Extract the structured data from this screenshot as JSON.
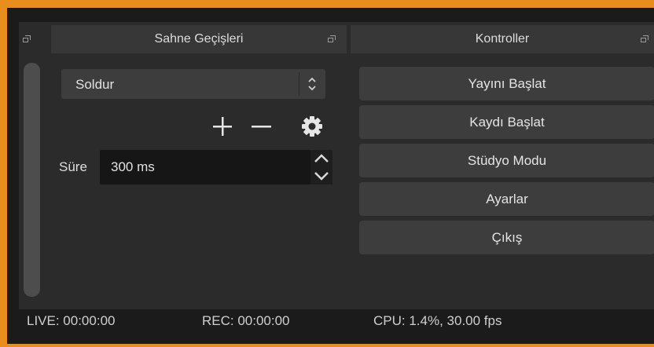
{
  "transitions_panel": {
    "title": "Sahne Geçişleri",
    "transition_select": {
      "value": "Soldur"
    },
    "duration": {
      "label": "Süre",
      "value": "300 ms"
    },
    "icons": {
      "add": "plus-icon",
      "remove": "minus-icon",
      "settings": "gear-icon"
    }
  },
  "controls_panel": {
    "title": "Kontroller",
    "buttons": [
      {
        "label": "Yayını Başlat"
      },
      {
        "label": "Kaydı Başlat"
      },
      {
        "label": "Stüdyo Modu"
      },
      {
        "label": "Ayarlar"
      },
      {
        "label": "Çıkış"
      }
    ]
  },
  "status_bar": {
    "live": "LIVE: 00:00:00",
    "rec": "REC: 00:00:00",
    "cpu": "CPU: 1.4%, 30.00 fps"
  },
  "colors": {
    "frame_border": "#e88e1d",
    "panel_bg": "#2b2b2b",
    "button_bg": "#3d3d3d",
    "header_bg": "#373737"
  }
}
